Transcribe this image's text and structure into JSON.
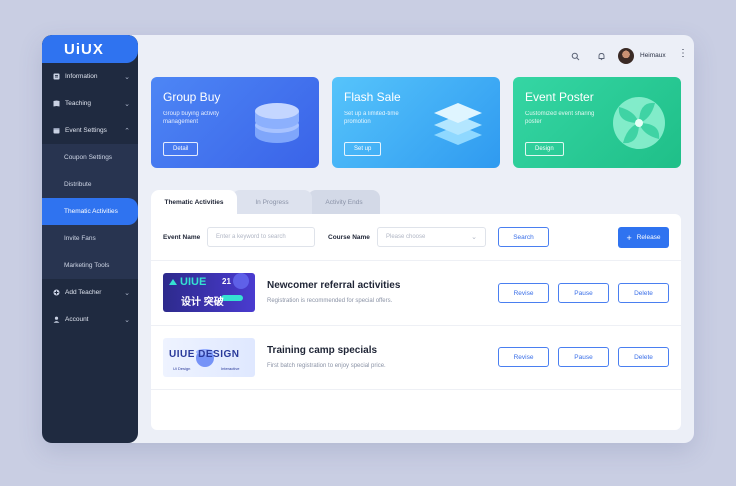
{
  "app": {
    "logo": "UiUX"
  },
  "sidebar": {
    "items": [
      {
        "label": "Information",
        "icon": "info-icon",
        "chevron": "⌄"
      },
      {
        "label": "Teaching",
        "icon": "book-icon",
        "chevron": "⌄"
      },
      {
        "label": "Event Settings",
        "icon": "calendar-icon",
        "chevron": "⌃"
      },
      {
        "label": "Coupon Settings"
      },
      {
        "label": "Distribute"
      },
      {
        "label": "Thematic Activities"
      },
      {
        "label": "Invite Fans"
      },
      {
        "label": "Marketing Tools"
      },
      {
        "label": "Add Teacher",
        "icon": "plus-icon",
        "chevron": "⌄"
      },
      {
        "label": "Account",
        "icon": "user-icon",
        "chevron": "⌄"
      }
    ]
  },
  "topbar": {
    "username": "Heimaux",
    "more": "⋮"
  },
  "cards": [
    {
      "title": "Group Buy",
      "desc": "Group buying activity management",
      "button": "Detail"
    },
    {
      "title": "Flash Sale",
      "desc": "Set up a limited-time promotion",
      "button": "Set up"
    },
    {
      "title": "Event Poster",
      "desc": "Customized event sharing poster",
      "button": "Design"
    }
  ],
  "tabs": [
    "Thematic Activities",
    "In Progress",
    "Activity Ends"
  ],
  "filters": {
    "event_name_label": "Event Name",
    "event_name_placeholder": "Enter a keyword to search",
    "course_name_label": "Course Name",
    "course_name_placeholder": "Please choose",
    "search_button": "Search",
    "release_button": "Release"
  },
  "activities": [
    {
      "title": "Newcomer referral activities",
      "subtitle": "Registration is recommended for special offers.",
      "thumb_line1": "UIUE",
      "thumb_year": "21",
      "thumb_line2": "设计 突破",
      "actions": [
        "Revise",
        "Pause",
        "Delete"
      ]
    },
    {
      "title": "Training camp specials",
      "subtitle": "First batch registration to enjoy special price.",
      "thumb_line1": "UIUE DESIGN",
      "thumb_caption_left": "Ui Design",
      "thumb_caption_right": "Interactive",
      "actions": [
        "Revise",
        "Pause",
        "Delete"
      ]
    }
  ],
  "colors": {
    "accent": "#2f73f0",
    "sidebar": "#1f2a40",
    "card_blue": "#4d86f5",
    "card_sky": "#56c4fb",
    "card_green": "#35d6a4"
  }
}
